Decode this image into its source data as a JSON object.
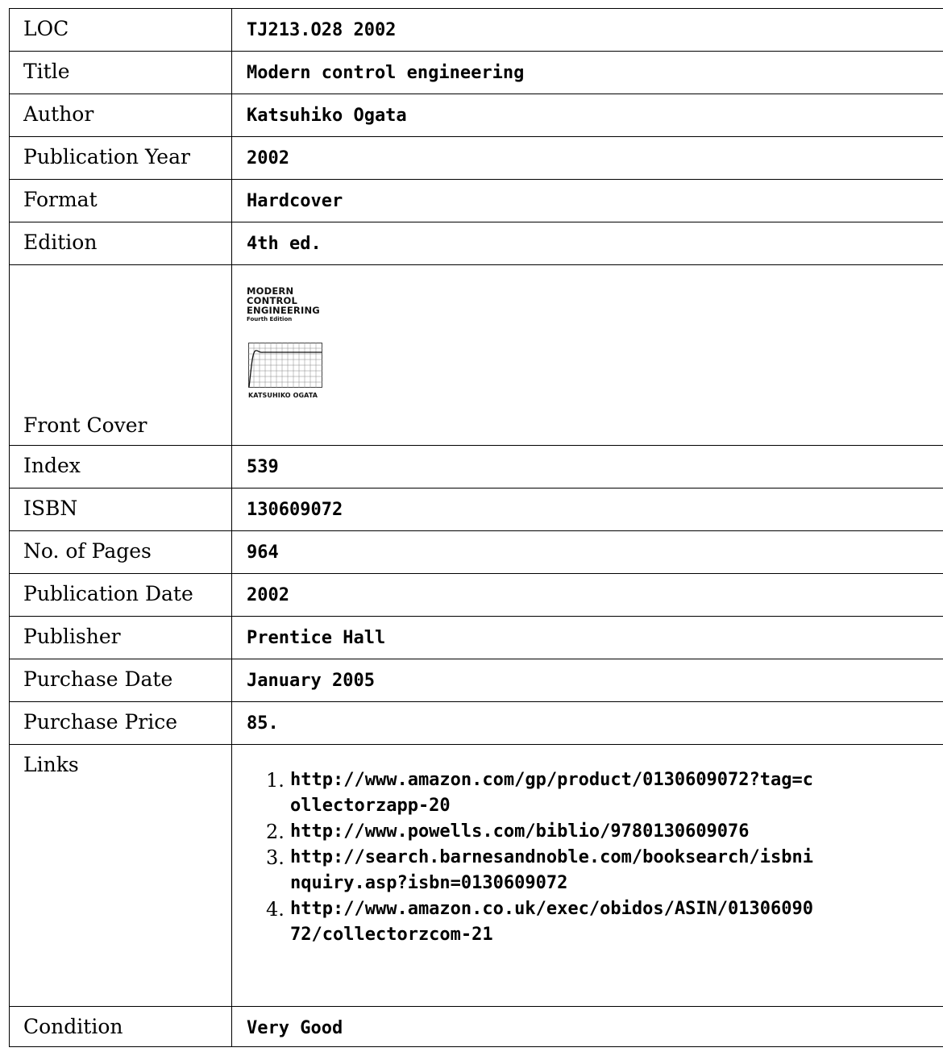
{
  "rows": [
    {
      "label": "LOC",
      "value": "TJ213.O28 2002"
    },
    {
      "label": "Title",
      "value": "Modern control engineering"
    },
    {
      "label": "Author",
      "value": "Katsuhiko Ogata"
    },
    {
      "label": "Publication Year",
      "value": "2002"
    },
    {
      "label": "Format",
      "value": "Hardcover"
    },
    {
      "label": "Edition",
      "value": "4th ed."
    }
  ],
  "cover": {
    "label": "Front Cover",
    "image_title_lines": [
      "MODERN",
      "CONTROL",
      "ENGINEERING"
    ],
    "image_edition": "Fourth Edition",
    "image_author": "KATSUHIKO OGATA"
  },
  "rows2": [
    {
      "label": "Index",
      "value": "539"
    },
    {
      "label": "ISBN",
      "value": "130609072"
    },
    {
      "label": "No. of Pages",
      "value": "964"
    },
    {
      "label": "Publication Date",
      "value": "2002"
    },
    {
      "label": "Publisher",
      "value": "Prentice Hall"
    },
    {
      "label": "Purchase Date",
      "value": "January 2005"
    },
    {
      "label": "Purchase Price",
      "value": "85."
    }
  ],
  "links": {
    "label": "Links",
    "items": [
      "http://www.amazon.com/gp/product/0130609072?tag=collectorzapp-20",
      "http://www.powells.com/biblio/9780130609076",
      "http://search.barnesandnoble.com/booksearch/isbninquiry.asp?isbn=0130609072",
      "http://www.amazon.co.uk/exec/obidos/ASIN/0130609072/collectorzcom-21"
    ]
  },
  "condition": {
    "label": "Condition",
    "value": "Very Good"
  }
}
